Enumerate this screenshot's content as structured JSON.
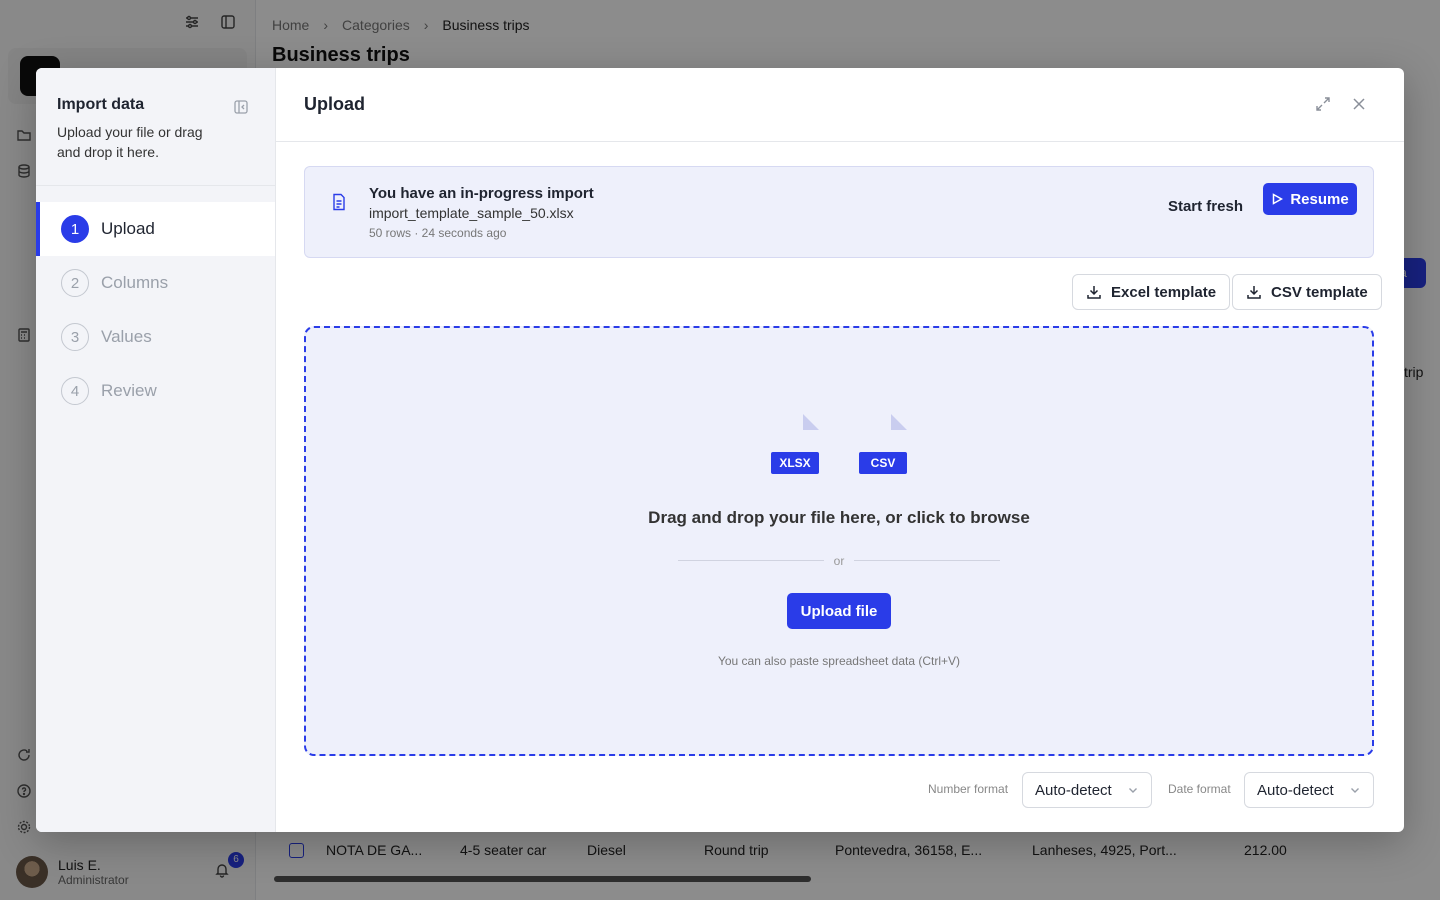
{
  "background": {
    "breadcrumb": [
      "Home",
      "Categories",
      "Business trips"
    ],
    "page_title": "Business trips",
    "user": {
      "name": "Luis E.",
      "role": "Administrator",
      "notification_count": "6"
    },
    "partial_button_label": "ta",
    "partial_column_label": "trip",
    "table_row": [
      "NOTA DE GA...",
      "4-5 seater car",
      "Diesel",
      "Round trip",
      "Pontevedra, 36158, E...",
      "Lanheses, 4925, Port...",
      "212.00"
    ]
  },
  "modal": {
    "sidebar": {
      "title": "Import data",
      "description": "Upload your file or drag and drop it here.",
      "steps": [
        {
          "number": "1",
          "label": "Upload",
          "active": true
        },
        {
          "number": "2",
          "label": "Columns",
          "active": false
        },
        {
          "number": "3",
          "label": "Values",
          "active": false
        },
        {
          "number": "4",
          "label": "Review",
          "active": false
        }
      ]
    },
    "header": {
      "title": "Upload"
    },
    "in_progress": {
      "title": "You have an in-progress import",
      "filename": "import_template_sample_50.xlsx",
      "meta": "50 rows · 24 seconds ago",
      "start_fresh_label": "Start fresh",
      "resume_label": "Resume"
    },
    "templates": {
      "excel_label": "Excel template",
      "csv_label": "CSV template"
    },
    "dropzone": {
      "file_types": [
        "XLSX",
        "CSV"
      ],
      "prompt": "Drag and drop your file here, or click to browse",
      "or_text": "or",
      "upload_label": "Upload file",
      "paste_hint": "You can also paste spreadsheet data (Ctrl+V)"
    },
    "formats": {
      "number_label": "Number format",
      "number_value": "Auto-detect",
      "date_label": "Date format",
      "date_value": "Auto-detect"
    }
  },
  "colors": {
    "accent": "#2a3ce8",
    "dropzone_bg": "#eef0fb",
    "overlay": "rgba(0,0,0,0.45)"
  }
}
